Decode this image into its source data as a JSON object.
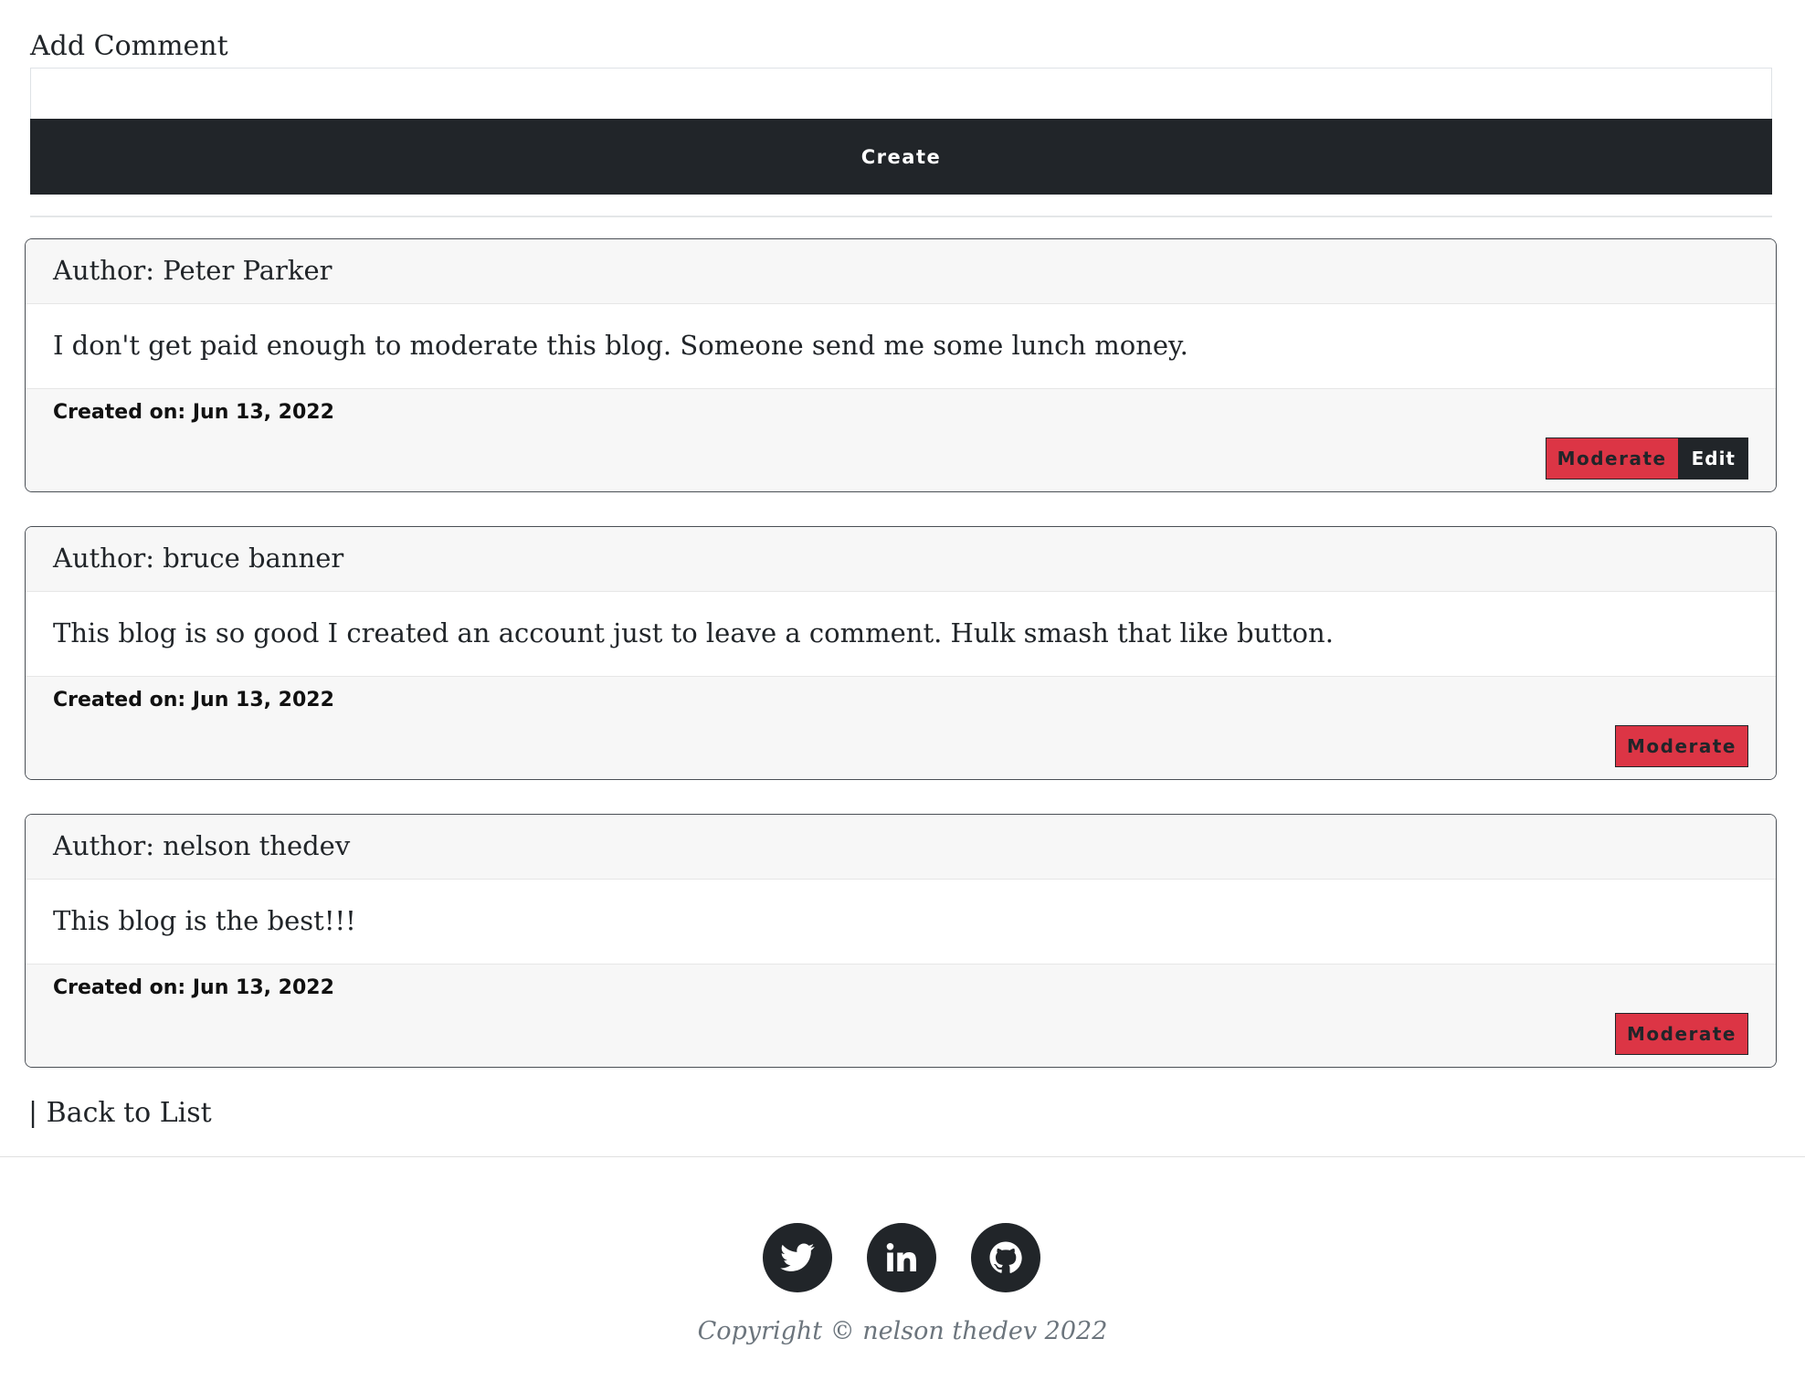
{
  "form": {
    "label": "Add Comment",
    "input_value": "",
    "input_placeholder": "",
    "create_label": "Create"
  },
  "comments": [
    {
      "author_prefix": "Author:",
      "author": "Peter Parker",
      "body": "I don't get paid enough to moderate this blog. Someone send me some lunch money.",
      "created_label": "Created on: Jun 13, 2022",
      "moderate_label": "Moderate",
      "edit_label": "Edit"
    },
    {
      "author_prefix": "Author:",
      "author": "bruce banner",
      "body": "This blog is so good I created an account just to leave a comment. Hulk smash that like button.",
      "created_label": "Created on: Jun 13, 2022",
      "moderate_label": "Moderate"
    },
    {
      "author_prefix": "Author:",
      "author": "nelson thedev",
      "body": "This blog is the best!!!",
      "created_label": "Created on: Jun 13, 2022",
      "moderate_label": "Moderate"
    }
  ],
  "nav": {
    "back_link": "| Back to List"
  },
  "footer": {
    "social": [
      {
        "icon": "twitter-icon"
      },
      {
        "icon": "linkedin-icon"
      },
      {
        "icon": "github-icon"
      }
    ],
    "copyright": "Copyright © nelson thedev 2022"
  },
  "colors": {
    "dark": "#212529",
    "danger": "#dc3545",
    "muted": "#6c757d",
    "card_bg": "#f7f7f7"
  }
}
